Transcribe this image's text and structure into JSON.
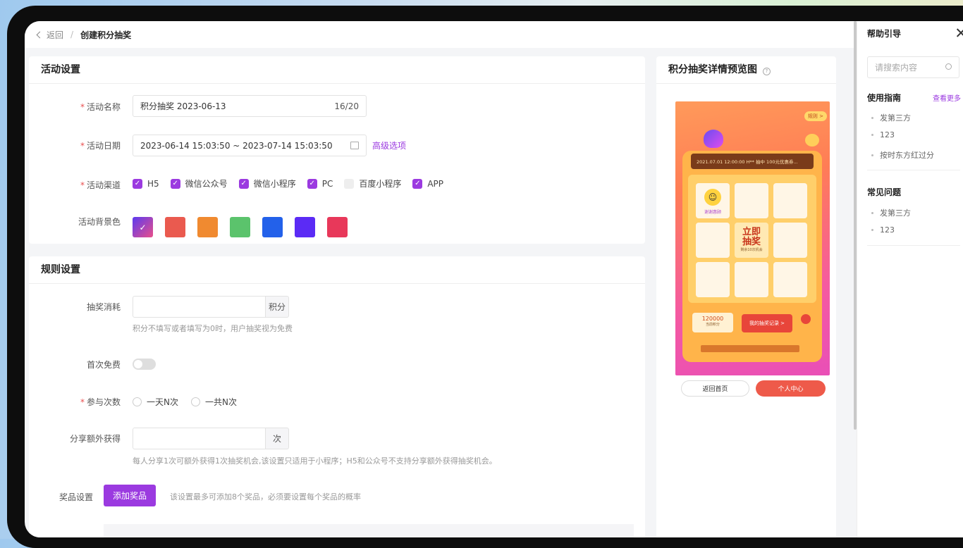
{
  "breadcrumb": {
    "back": "返回",
    "current": "创建积分抽奖"
  },
  "activity": {
    "title": "活动设置",
    "name_label": "活动名称",
    "name_value": "积分抽奖  2023-06-13",
    "name_count": "16/20",
    "date_label": "活动日期",
    "date_value": "2023-06-14 15:03:50 ~ 2023-07-14 15:03:50",
    "advanced": "高级选项",
    "channel_label": "活动渠道",
    "channels": [
      {
        "label": "H5",
        "checked": true
      },
      {
        "label": "微信公众号",
        "checked": true
      },
      {
        "label": "微信小程序",
        "checked": true
      },
      {
        "label": "PC",
        "checked": true
      },
      {
        "label": "百度小程序",
        "checked": false
      },
      {
        "label": "APP",
        "checked": true
      }
    ],
    "bg_label": "活动背景色",
    "colors": [
      "#8f3ae8",
      "#ea5a4f",
      "#f08a30",
      "#5bc36c",
      "#2361ea",
      "#5b2bf5",
      "#e8385a"
    ]
  },
  "rules": {
    "title": "规则设置",
    "cost_label": "抽奖消耗",
    "cost_addon": "积分",
    "cost_hint": "积分不填写或者填写为0时，用户抽奖视为免费",
    "free_label": "首次免费",
    "times_label": "参与次数",
    "times_opt1": "一天N次",
    "times_opt2": "一共N次",
    "share_label": "分享额外获得",
    "share_addon": "次",
    "share_hint": "每人分享1次可额外获得1次抽奖机会,该设置只适用于小程序；H5和公众号不支持分享额外获得抽奖机会。",
    "prize_label": "奖品设置",
    "prize_button": "添加奖品",
    "prize_hint": "该设置最多可添加8个奖品，必须要设置每个奖品的概率"
  },
  "preview": {
    "title": "积分抽奖详情预览图",
    "rule_tag": "规则 >",
    "marquee": "2021.07.01 12:00:00  H** 抽中 100元优惠券...",
    "thanks": "谢谢惠顾",
    "draw_line1": "立即",
    "draw_line2": "抽奖",
    "draw_sub": "剩余10次机会",
    "points_value": "120000",
    "points_label": "当前积分",
    "records": "我的抽奖记录 >",
    "btn_home": "返回首页",
    "btn_center": "个人中心"
  },
  "help": {
    "title": "帮助引导",
    "search_placeholder": "请搜索内容",
    "guide_title": "使用指南",
    "guide_more": "查看更多",
    "guide_items": [
      "发第三方",
      "123",
      "按时东方红过分"
    ],
    "faq_title": "常见问题",
    "faq_items": [
      "发第三方",
      "123"
    ]
  }
}
